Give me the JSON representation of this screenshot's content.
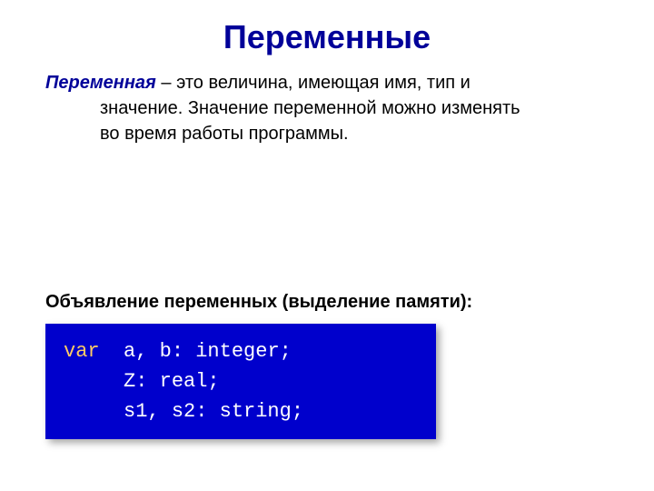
{
  "title": "Переменные",
  "definition": {
    "term": "Переменная",
    "dash": " – ",
    "text_line1": "это величина, имеющая имя, тип и",
    "text_line2": "значение. Значение переменной можно изменять",
    "text_line3": "во время работы программы."
  },
  "section_heading": "Объявление переменных (выделение памяти):",
  "code": {
    "keyword": "var",
    "line1_rest": "  a, b: integer;",
    "line2": "     Z: real;",
    "line3": "     s1, s2: string;"
  }
}
